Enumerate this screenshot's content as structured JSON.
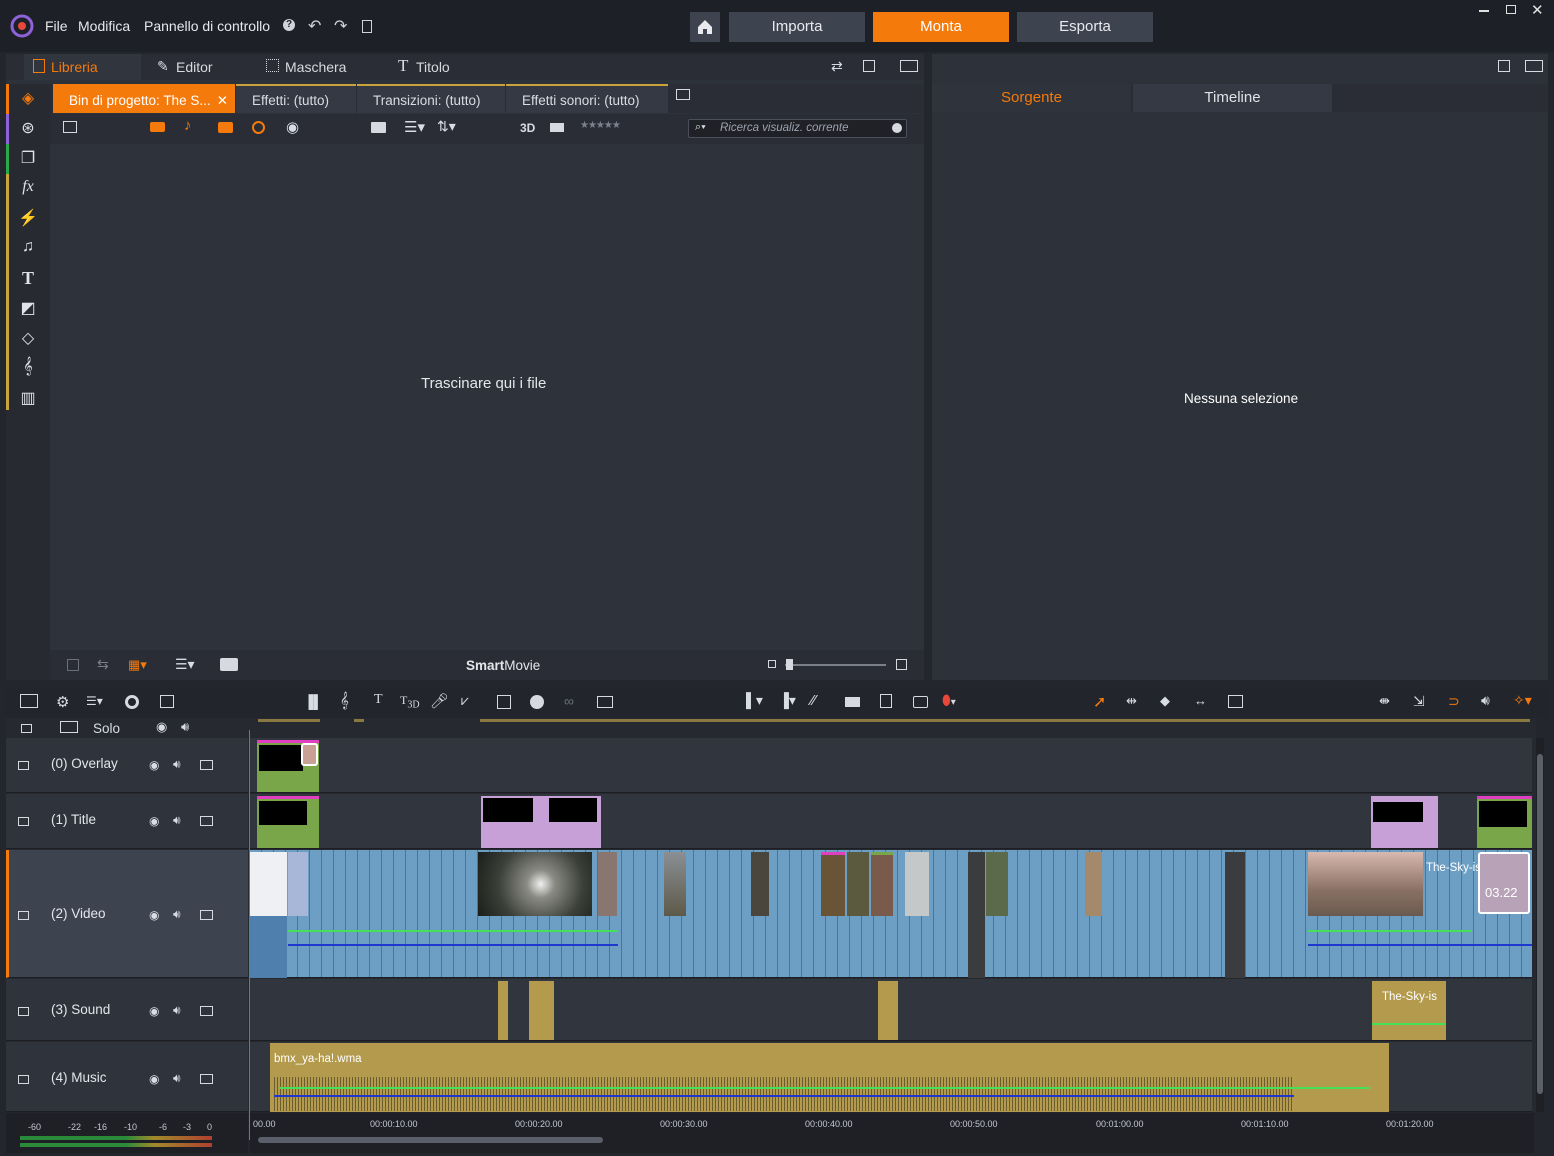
{
  "menu": {
    "file": "File",
    "modifica": "Modifica",
    "pannello": "Pannello di controllo"
  },
  "nav": {
    "importa": "Importa",
    "monta": "Monta",
    "esporta": "Esporta"
  },
  "lib_tabs": {
    "libreria": "Libreria",
    "editor": "Editor",
    "maschera": "Maschera",
    "titolo": "Titolo"
  },
  "bin_tabs": {
    "bin": "Bin di progetto: The S...",
    "effetti": "Effetti: (tutto)",
    "transizioni": "Transizioni: (tutto)",
    "sonori": "Effetti sonori: (tutto)"
  },
  "tool": {
    "three_d": "3D",
    "search_placeholder": "Ricerca visualiz. corrente"
  },
  "dropzone": "Trascinare qui i file",
  "smartmovie": {
    "bold": "Smart",
    "rest": "Movie"
  },
  "preview": {
    "sorgente": "Sorgente",
    "timeline": "Timeline",
    "empty": "Nessuna selezione"
  },
  "timeline": {
    "solo": "Solo",
    "tracks": [
      "(0) Overlay",
      "(1) Title",
      "(2) Video",
      "(3) Sound",
      "(4) Music"
    ],
    "music_clip": "bmx_ya-ha!.wma",
    "sound_clip": "The-Sky-is",
    "video_clip_label": "The-Sky-is-t",
    "clip_time": "03.22",
    "ruler": [
      "00.00",
      "00:00:10.00",
      "00:00:20.00",
      "00:00:30.00",
      "00:00:40.00",
      "00:00:50.00",
      "00:01:00.00",
      "00:01:10.00",
      "00:01:20.00"
    ],
    "meter": [
      "-60",
      "-22",
      "-16",
      "-10",
      "-6",
      "-3",
      "0"
    ]
  },
  "colors": {
    "accent": "#f57a0c",
    "video": "#6d9ec4",
    "audio": "#b39a4d",
    "title": "#c7a0d8"
  }
}
